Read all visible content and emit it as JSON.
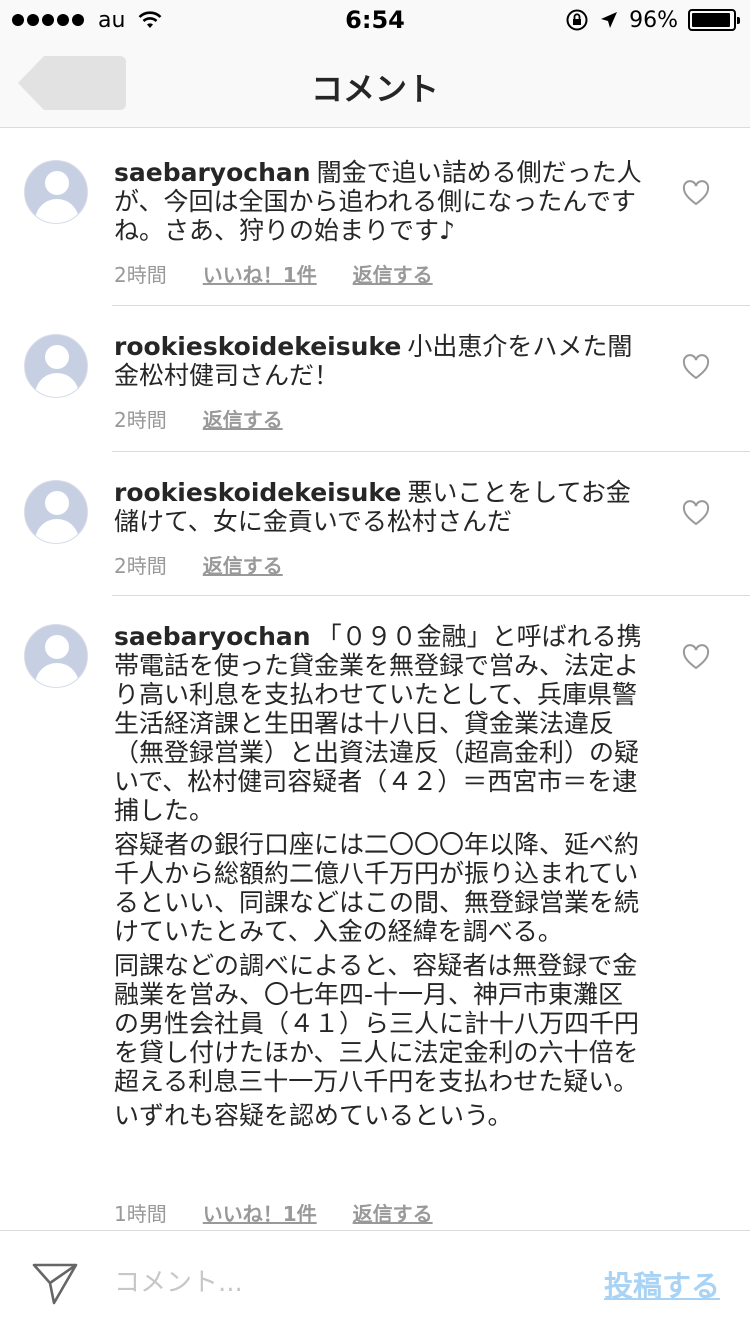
{
  "status_bar": {
    "carrier": "au",
    "time": "6:54",
    "battery": "96%",
    "battery_level": 0.96
  },
  "nav": {
    "title": "コメント",
    "back_icon": "back-arrow-icon"
  },
  "comments": [
    {
      "username": "saebaryochan",
      "paragraphs": [
        "闇金で追い詰める側だった人が、今回は全国から追われる側になったんですね。さあ、狩りの始まりです♪"
      ],
      "time": "2時間",
      "likes": "いいね！1件",
      "reply": "返信する"
    },
    {
      "username": "rookieskoidekeisuke",
      "paragraphs": [
        "小出恵介をハメた闇金松村健司さんだ！"
      ],
      "time": "2時間",
      "reply": "返信する"
    },
    {
      "username": "rookieskoidekeisuke",
      "paragraphs": [
        "悪いことをしてお金儲けて、女に金貢いでる松村さんだ"
      ],
      "time": "2時間",
      "reply": "返信する"
    },
    {
      "username": "saebaryochan",
      "paragraphs": [
        "「０９０金融」と呼ばれる携帯電話を使った貸金業を無登録で営み、法定より高い利息を支払わせていたとして、兵庫県警生活経済課と生田署は十八日、貸金業法違反（無登録営業）と出資法違反（超高金利）の疑いで、松村健司容疑者（４２）＝西宮市＝を逮捕した。",
        "容疑者の銀行口座には二〇〇〇年以降、延べ約千人から総額約二億八千万円が振り込まれているといい、同課などはこの間、無登録営業を続けていたとみて、入金の経緯を調べる。",
        "同課などの調べによると、容疑者は無登録で金融業を営み、〇七年四-十一月、神戸市東灘区の男性会社員（４１）ら三人に計十八万四千円を貸し付けたほか、三人に法定金利の六十倍を超える利息三十一万八千円を支払わせた疑い。",
        "いずれも容疑を認めているという。"
      ],
      "time": "1時間",
      "likes": "いいね！1件",
      "reply": "返信する"
    }
  ],
  "compose": {
    "placeholder": "コメント...",
    "post_label": "投稿する"
  },
  "colors": {
    "post_button": "#a8d3f5",
    "avatar": "#c7cfe2",
    "meta_text": "#999999",
    "divider": "#dbdbdb"
  }
}
